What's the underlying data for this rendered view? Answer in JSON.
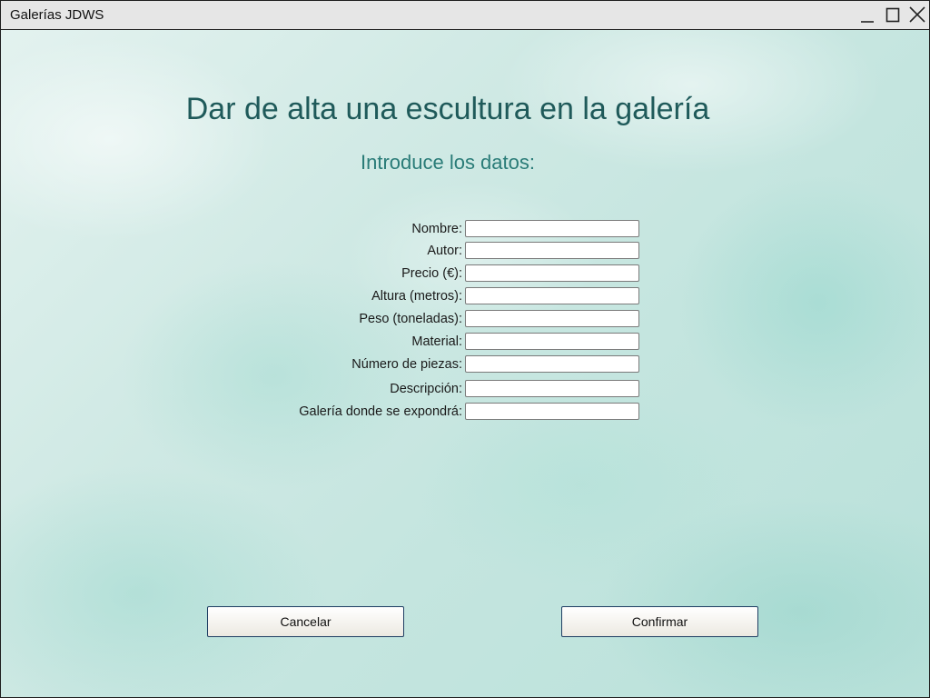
{
  "window": {
    "title": "Galerías JDWS"
  },
  "heading": "Dar de alta una escultura en la galería",
  "subheading": "Introduce los datos:",
  "form": {
    "fields": [
      {
        "label": "Nombre:",
        "value": ""
      },
      {
        "label": "Autor:",
        "value": ""
      },
      {
        "label": "Precio (€):",
        "value": ""
      },
      {
        "label": "Altura (metros):",
        "value": ""
      },
      {
        "label": "Peso (toneladas):",
        "value": ""
      },
      {
        "label": "Material:",
        "value": ""
      },
      {
        "label": "Número de piezas:",
        "value": ""
      },
      {
        "label": "Descripción:",
        "value": ""
      },
      {
        "label": "Galería donde se expondrá:",
        "value": ""
      }
    ]
  },
  "buttons": {
    "cancel_label": "Cancelar",
    "confirm_label": "Confirmar"
  },
  "icons": {
    "minimize": "minimize-icon",
    "maximize": "maximize-icon",
    "close": "close-icon"
  },
  "colors": {
    "heading": "#1f5a5a",
    "subheading": "#2a7c78",
    "button_border": "#1f3e63"
  }
}
